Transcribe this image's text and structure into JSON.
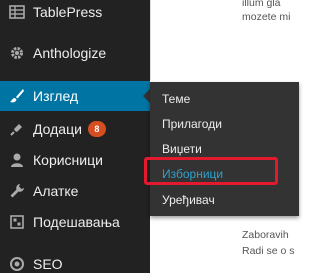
{
  "sidebar": {
    "items": [
      {
        "id": "tablepress",
        "label": "TablePress",
        "icon": "table-icon"
      },
      {
        "id": "anthologize",
        "label": "Anthologize",
        "icon": "gear-icon"
      },
      {
        "id": "appearance",
        "label": "Изглед",
        "icon": "paintbrush-icon",
        "active": true
      },
      {
        "id": "plugins",
        "label": "Додаци",
        "icon": "plug-icon",
        "badge": "8"
      },
      {
        "id": "users",
        "label": "Корисници",
        "icon": "user-icon"
      },
      {
        "id": "tools",
        "label": "Алатке",
        "icon": "wrench-icon"
      },
      {
        "id": "settings",
        "label": "Подешавања",
        "icon": "settings-icon"
      },
      {
        "id": "seo",
        "label": "SEO",
        "icon": "seo-icon"
      }
    ]
  },
  "submenu": {
    "items": [
      {
        "label": "Теме"
      },
      {
        "label": "Прилагоди"
      },
      {
        "label": "Виџети"
      },
      {
        "label": "Изборници",
        "current": true
      },
      {
        "label": "Уређивач"
      }
    ]
  },
  "background_text": {
    "top_line1": "illum gla",
    "top_line2": "mozete mi",
    "bottom_line1": "Zaboravih",
    "bottom_line2": "Radi se o s"
  },
  "colors": {
    "sidebar_bg": "#222222",
    "active_bg": "#0074a2",
    "flyout_bg": "#333333",
    "current_link": "#2ea2cc",
    "highlight_border": "#e3192e",
    "badge_bg": "#d54e21"
  }
}
